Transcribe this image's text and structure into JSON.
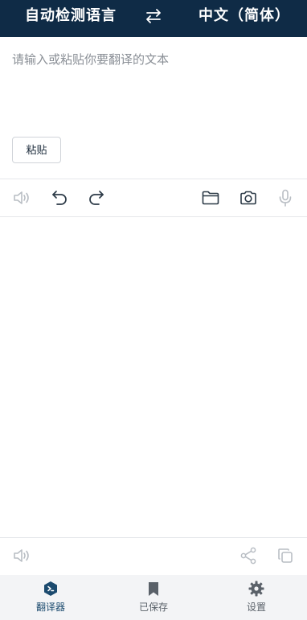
{
  "header": {
    "source_language": "自动检测语言",
    "target_language": "中文（简体）"
  },
  "input": {
    "placeholder": "请输入或粘贴你要翻译的文本",
    "paste_label": "粘贴"
  },
  "toolbar": {
    "icons": [
      "speaker-icon",
      "undo-icon",
      "redo-icon",
      "folder-icon",
      "camera-icon",
      "microphone-icon"
    ]
  },
  "output_toolbar": {
    "icons": [
      "speaker-icon",
      "share-icon",
      "copy-icon"
    ]
  },
  "bottom_nav": {
    "items": [
      {
        "label": "翻译器",
        "icon": "translator-icon",
        "active": true
      },
      {
        "label": "已保存",
        "icon": "bookmark-icon",
        "active": false
      },
      {
        "label": "设置",
        "icon": "gear-icon",
        "active": false
      }
    ]
  },
  "colors": {
    "header_bg": "#0f2b46",
    "accent": "#1b4a6e",
    "nav_bg": "#f3f4f6"
  }
}
